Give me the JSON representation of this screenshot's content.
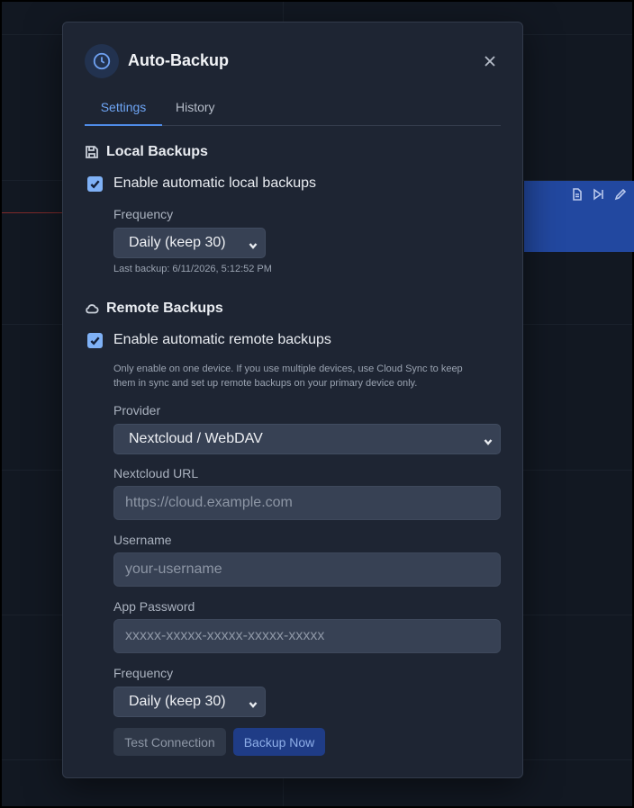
{
  "modal": {
    "title": "Auto-Backup",
    "icon": "clock-icon"
  },
  "tabs": [
    {
      "label": "Settings",
      "active": true
    },
    {
      "label": "History",
      "active": false
    }
  ],
  "local": {
    "heading": "Local Backups",
    "enable_label": "Enable automatic local backups",
    "enabled": true,
    "frequency_label": "Frequency",
    "frequency_value": "Daily (keep 30)",
    "last_backup": "Last backup: 6/11/2026, 5:12:52 PM"
  },
  "remote": {
    "heading": "Remote Backups",
    "enable_label": "Enable automatic remote backups",
    "enabled": true,
    "hint_line1": "Only enable on one device. If you use multiple devices, use Cloud Sync to keep",
    "hint_line2": "them in sync and set up remote backups on your primary device only.",
    "provider_label": "Provider",
    "provider_value": "Nextcloud / WebDAV",
    "url_label": "Nextcloud URL",
    "url_placeholder": "https://cloud.example.com",
    "username_label": "Username",
    "username_placeholder": "your-username",
    "password_label": "App Password",
    "password_placeholder": "xxxxx-xxxxx-xxxxx-xxxxx-xxxxx",
    "frequency_label": "Frequency",
    "frequency_value": "Daily (keep 30)"
  },
  "buttons": {
    "test": "Test Connection",
    "backup": "Backup Now"
  },
  "colors": {
    "accent": "#4f8ce8",
    "modal_bg": "#1e2533",
    "primary_button": "#1f3c86"
  }
}
